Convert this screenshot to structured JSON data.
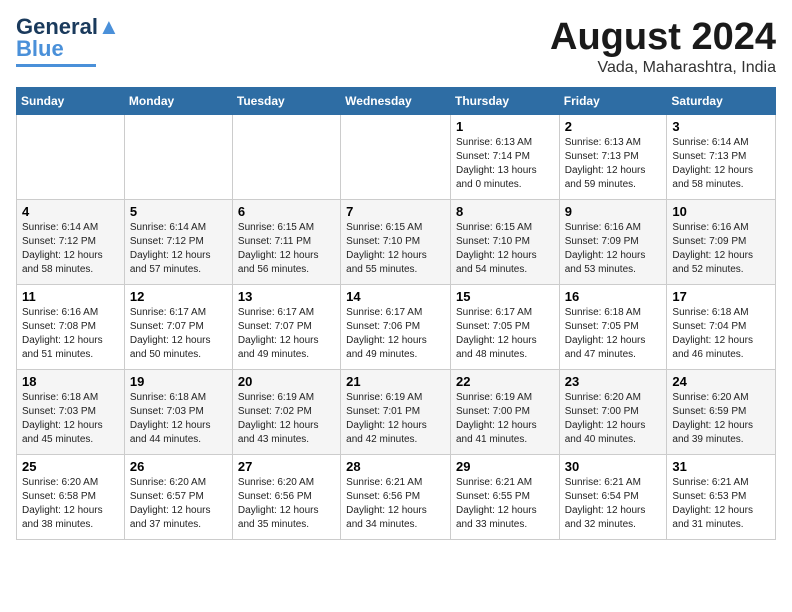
{
  "logo": {
    "line1": "General",
    "line2": "Blue"
  },
  "header": {
    "month": "August 2024",
    "location": "Vada, Maharashtra, India"
  },
  "weekdays": [
    "Sunday",
    "Monday",
    "Tuesday",
    "Wednesday",
    "Thursday",
    "Friday",
    "Saturday"
  ],
  "weeks": [
    [
      {
        "day": "",
        "info": ""
      },
      {
        "day": "",
        "info": ""
      },
      {
        "day": "",
        "info": ""
      },
      {
        "day": "",
        "info": ""
      },
      {
        "day": "1",
        "info": "Sunrise: 6:13 AM\nSunset: 7:14 PM\nDaylight: 13 hours\nand 0 minutes."
      },
      {
        "day": "2",
        "info": "Sunrise: 6:13 AM\nSunset: 7:13 PM\nDaylight: 12 hours\nand 59 minutes."
      },
      {
        "day": "3",
        "info": "Sunrise: 6:14 AM\nSunset: 7:13 PM\nDaylight: 12 hours\nand 58 minutes."
      }
    ],
    [
      {
        "day": "4",
        "info": "Sunrise: 6:14 AM\nSunset: 7:12 PM\nDaylight: 12 hours\nand 58 minutes."
      },
      {
        "day": "5",
        "info": "Sunrise: 6:14 AM\nSunset: 7:12 PM\nDaylight: 12 hours\nand 57 minutes."
      },
      {
        "day": "6",
        "info": "Sunrise: 6:15 AM\nSunset: 7:11 PM\nDaylight: 12 hours\nand 56 minutes."
      },
      {
        "day": "7",
        "info": "Sunrise: 6:15 AM\nSunset: 7:10 PM\nDaylight: 12 hours\nand 55 minutes."
      },
      {
        "day": "8",
        "info": "Sunrise: 6:15 AM\nSunset: 7:10 PM\nDaylight: 12 hours\nand 54 minutes."
      },
      {
        "day": "9",
        "info": "Sunrise: 6:16 AM\nSunset: 7:09 PM\nDaylight: 12 hours\nand 53 minutes."
      },
      {
        "day": "10",
        "info": "Sunrise: 6:16 AM\nSunset: 7:09 PM\nDaylight: 12 hours\nand 52 minutes."
      }
    ],
    [
      {
        "day": "11",
        "info": "Sunrise: 6:16 AM\nSunset: 7:08 PM\nDaylight: 12 hours\nand 51 minutes."
      },
      {
        "day": "12",
        "info": "Sunrise: 6:17 AM\nSunset: 7:07 PM\nDaylight: 12 hours\nand 50 minutes."
      },
      {
        "day": "13",
        "info": "Sunrise: 6:17 AM\nSunset: 7:07 PM\nDaylight: 12 hours\nand 49 minutes."
      },
      {
        "day": "14",
        "info": "Sunrise: 6:17 AM\nSunset: 7:06 PM\nDaylight: 12 hours\nand 49 minutes."
      },
      {
        "day": "15",
        "info": "Sunrise: 6:17 AM\nSunset: 7:05 PM\nDaylight: 12 hours\nand 48 minutes."
      },
      {
        "day": "16",
        "info": "Sunrise: 6:18 AM\nSunset: 7:05 PM\nDaylight: 12 hours\nand 47 minutes."
      },
      {
        "day": "17",
        "info": "Sunrise: 6:18 AM\nSunset: 7:04 PM\nDaylight: 12 hours\nand 46 minutes."
      }
    ],
    [
      {
        "day": "18",
        "info": "Sunrise: 6:18 AM\nSunset: 7:03 PM\nDaylight: 12 hours\nand 45 minutes."
      },
      {
        "day": "19",
        "info": "Sunrise: 6:18 AM\nSunset: 7:03 PM\nDaylight: 12 hours\nand 44 minutes."
      },
      {
        "day": "20",
        "info": "Sunrise: 6:19 AM\nSunset: 7:02 PM\nDaylight: 12 hours\nand 43 minutes."
      },
      {
        "day": "21",
        "info": "Sunrise: 6:19 AM\nSunset: 7:01 PM\nDaylight: 12 hours\nand 42 minutes."
      },
      {
        "day": "22",
        "info": "Sunrise: 6:19 AM\nSunset: 7:00 PM\nDaylight: 12 hours\nand 41 minutes."
      },
      {
        "day": "23",
        "info": "Sunrise: 6:20 AM\nSunset: 7:00 PM\nDaylight: 12 hours\nand 40 minutes."
      },
      {
        "day": "24",
        "info": "Sunrise: 6:20 AM\nSunset: 6:59 PM\nDaylight: 12 hours\nand 39 minutes."
      }
    ],
    [
      {
        "day": "25",
        "info": "Sunrise: 6:20 AM\nSunset: 6:58 PM\nDaylight: 12 hours\nand 38 minutes."
      },
      {
        "day": "26",
        "info": "Sunrise: 6:20 AM\nSunset: 6:57 PM\nDaylight: 12 hours\nand 37 minutes."
      },
      {
        "day": "27",
        "info": "Sunrise: 6:20 AM\nSunset: 6:56 PM\nDaylight: 12 hours\nand 35 minutes."
      },
      {
        "day": "28",
        "info": "Sunrise: 6:21 AM\nSunset: 6:56 PM\nDaylight: 12 hours\nand 34 minutes."
      },
      {
        "day": "29",
        "info": "Sunrise: 6:21 AM\nSunset: 6:55 PM\nDaylight: 12 hours\nand 33 minutes."
      },
      {
        "day": "30",
        "info": "Sunrise: 6:21 AM\nSunset: 6:54 PM\nDaylight: 12 hours\nand 32 minutes."
      },
      {
        "day": "31",
        "info": "Sunrise: 6:21 AM\nSunset: 6:53 PM\nDaylight: 12 hours\nand 31 minutes."
      }
    ]
  ]
}
